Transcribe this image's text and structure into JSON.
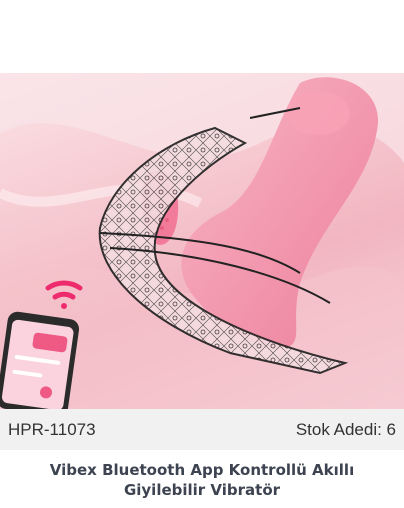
{
  "product": {
    "sku": "HPR-11073",
    "stock": "Stok Adedi: 6",
    "title": "Vibex Bluetooth App Kontrollü Akıllı Giyilebilir Vibratör"
  },
  "colors": {
    "meta_bg": "#f1f1f1",
    "title_color": "#3d4350",
    "wifi_icon": "#ee2b6c",
    "product_pink": "#f08aa3"
  },
  "icons": [
    "wifi-icon",
    "phone-illustration"
  ]
}
